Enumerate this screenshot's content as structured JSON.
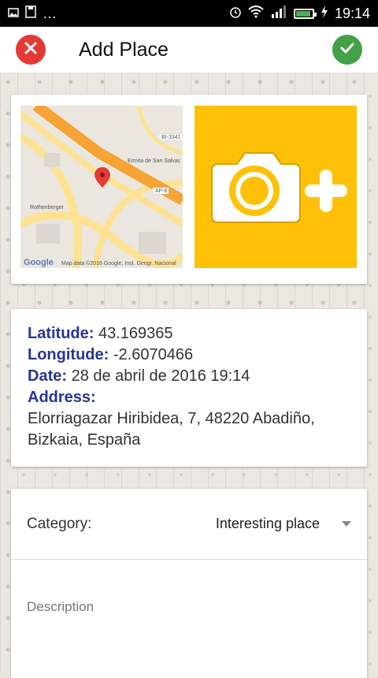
{
  "status_bar": {
    "time": "19:14",
    "more": "…"
  },
  "header": {
    "title": "Add Place"
  },
  "map": {
    "labels": {
      "road1": "BI-3341",
      "ermita": "Ermita de San Salvac",
      "road2": "AP-8",
      "place": "Rothenberger"
    },
    "google": "Google",
    "attribution": "Map data ©2016 Google, Inst. Geogr. Nacional"
  },
  "info": {
    "latitude_label": "Latitude:",
    "latitude_value": " 43.169365",
    "longitude_label": "Longitude:",
    "longitude_value": " -2.6070466",
    "date_label": "Date:",
    "date_value": " 28 de abril de 2016 19:14",
    "address_label": "Address:",
    "address_line1": "Elorriagazar Hiribidea, 7, 48220 Abadiño,",
    "address_line2": "Bizkaia, España"
  },
  "form": {
    "category_label": "Category:",
    "category_value": "Interesting place",
    "description_placeholder": "Description"
  },
  "colors": {
    "cancel": "#e53935",
    "confirm": "#43a047",
    "photo_bg": "#ffc107",
    "label": "#283593"
  }
}
